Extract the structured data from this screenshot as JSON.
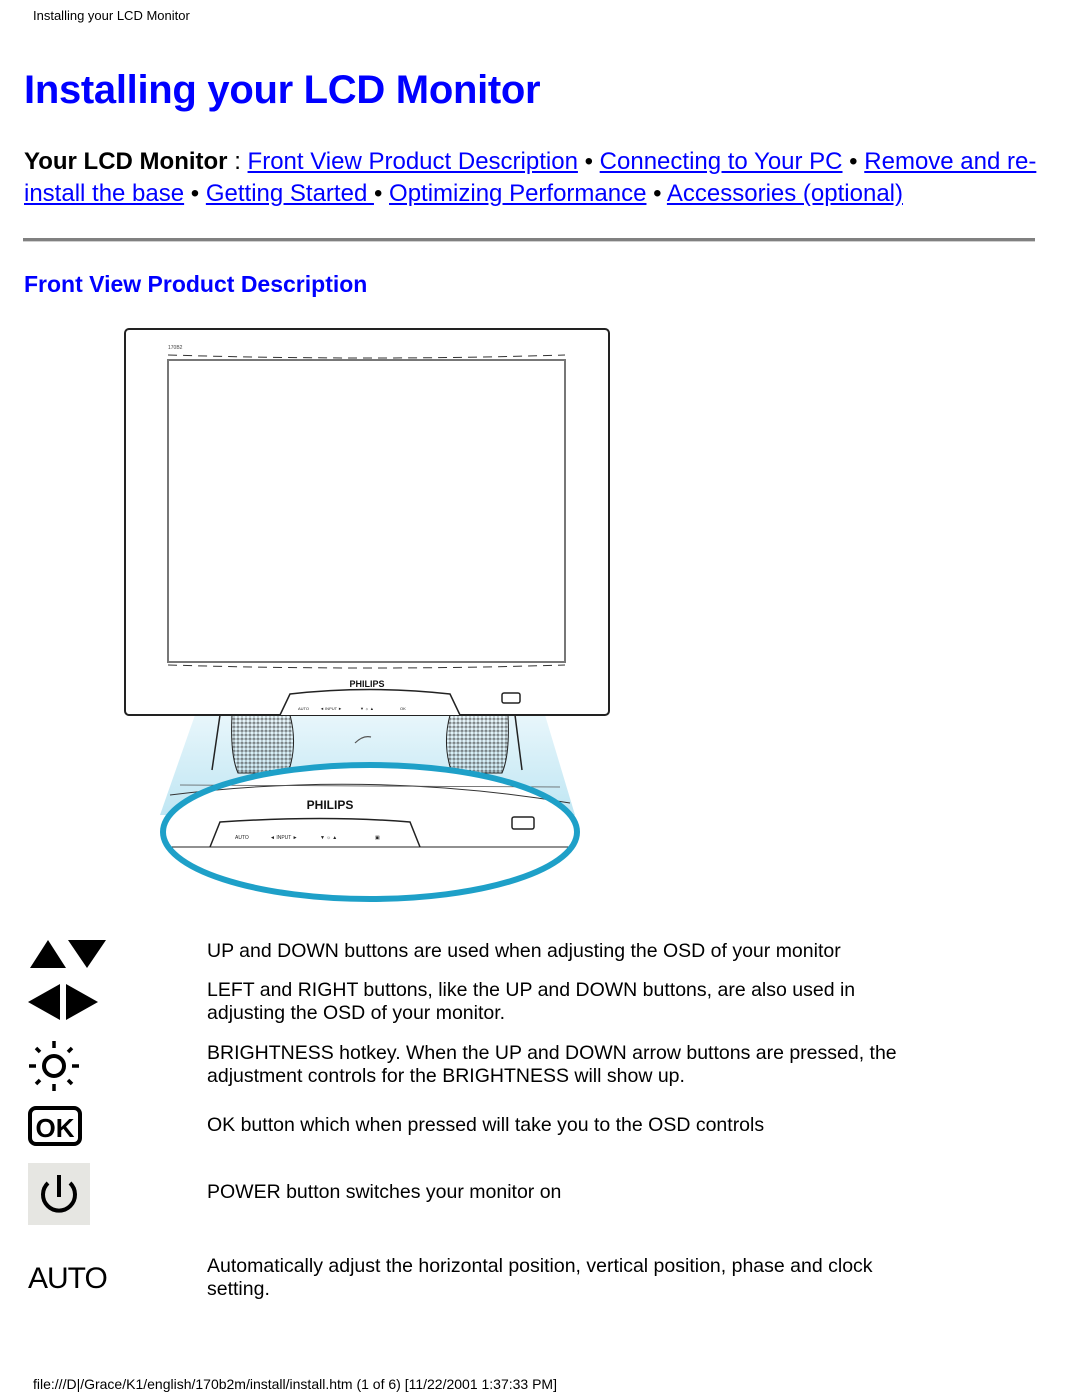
{
  "header": {
    "running_title": "Installing your LCD Monitor"
  },
  "page": {
    "title": "Installing your LCD Monitor",
    "link_color": "#0000ff"
  },
  "nav": {
    "lead": "Your LCD Monitor",
    "colon": " : ",
    "separator": " • ",
    "links": [
      {
        "label": "Front View Product Description"
      },
      {
        "label": "Connecting to Your PC"
      },
      {
        "label": "Remove and re-install the base"
      },
      {
        "label": "Getting Started "
      },
      {
        "label": "Optimizing Performance"
      },
      {
        "label": "Accessories (optional)"
      }
    ]
  },
  "section": {
    "title": "Front View Product Description"
  },
  "illustration": {
    "brand_label": "PHILIPS",
    "zoom_brand_label": "PHILIPS",
    "accent_color": "#1ea0c8"
  },
  "controls": [
    {
      "icon": "up-down-arrows-icon",
      "text": "UP and DOWN buttons are used when adjusting the OSD of your monitor"
    },
    {
      "icon": "left-right-arrows-icon",
      "text": "LEFT and RIGHT buttons, like the UP and DOWN buttons, are also used in adjusting the OSD of your monitor."
    },
    {
      "icon": "brightness-icon",
      "text": "BRIGHTNESS hotkey. When the UP and DOWN arrow buttons are pressed, the adjustment controls for the BRIGHTNESS will show up."
    },
    {
      "icon": "ok-icon",
      "icon_label": "OK",
      "text": "OK button which when pressed will take you to the OSD controls"
    },
    {
      "icon": "power-icon",
      "text": "POWER button switches your monitor on"
    },
    {
      "icon": "auto-icon",
      "icon_label": "AUTO",
      "text": "Automatically adjust the horizontal position, vertical position, phase and clock setting."
    }
  ],
  "footer": {
    "text": "file:///D|/Grace/K1/english/170b2m/install/install.htm (1 of 6) [11/22/2001 1:37:33 PM]"
  }
}
